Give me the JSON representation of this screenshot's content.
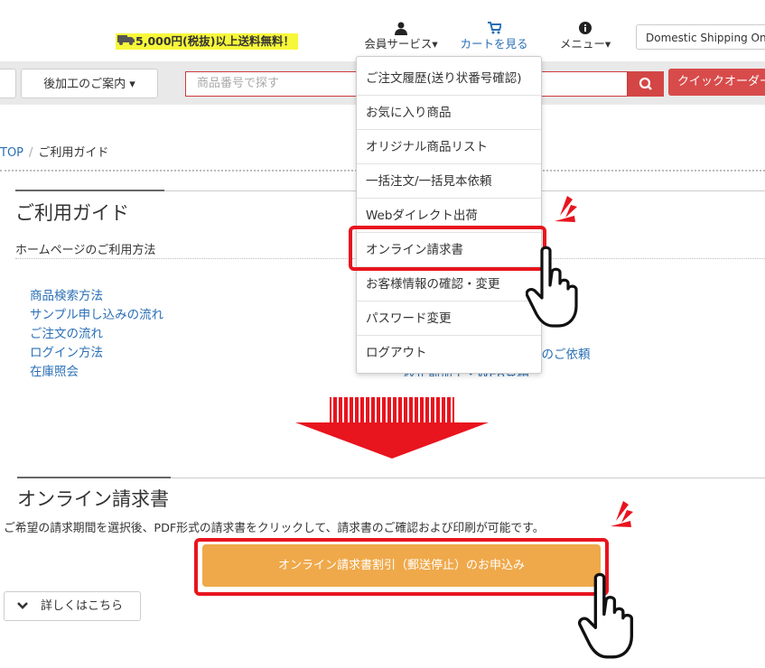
{
  "header": {
    "shipping_note": "5,000円(税抜)以上送料無料！",
    "member_services": "会員サービス▾",
    "cart": "カートを見る",
    "menu": "メニュー▾",
    "domestic_shipping": "Domestic Shipping Only"
  },
  "nav": {
    "post_processing": "後加工のご案内 ▾",
    "search_placeholder": "商品番号で探す",
    "quick_order": "クイックオーダー"
  },
  "breadcrumb": {
    "top": "TOP",
    "sep": "/",
    "current": "ご利用ガイド"
  },
  "guide": {
    "title": "ご利用ガイド",
    "subtitle": "ホームページのご利用方法",
    "links": [
      "商品検索方法",
      "サンプル申し込みの流れ",
      "ご注文の流れ",
      "ログイン方法",
      "在庫照会"
    ],
    "partial_right_1": "）のご依頼",
    "partial_right_2": "校正前加工・WEB見積"
  },
  "dropdown": {
    "items": [
      "ご注文履歴(送り状番号確認)",
      "お気に入り商品",
      "オリジナル商品リスト",
      "一括注文/一括見本依頼",
      "Webダイレクト出荷",
      "オンライン請求書",
      "お客様情報の確認・変更",
      "パスワード変更",
      "ログアウト"
    ]
  },
  "online_invoice": {
    "title": "オンライン請求書",
    "description": "ご希望の請求期間を選択後、PDF形式の請求書をクリックして、請求書のご確認および印刷が可能です。",
    "apply_button": "オンライン請求書割引（郵送停止）のお申込み",
    "details_button": "詳しくはこちら"
  },
  "colors": {
    "accent_red": "#e8141e",
    "link_blue": "#2a6fb6",
    "apply_orange": "#efa94a"
  }
}
